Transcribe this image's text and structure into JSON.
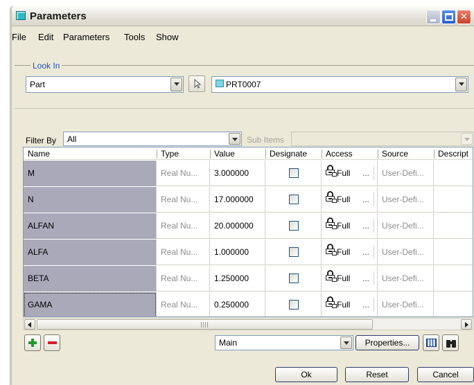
{
  "window": {
    "title": "Parameters"
  },
  "menu": [
    "File",
    "Edit",
    "Parameters",
    "Tools",
    "Show"
  ],
  "look_in": {
    "label": "Look In",
    "scope_value": "Part",
    "object_value": "PRT0007"
  },
  "filter": {
    "label": "Filter By",
    "value": "All",
    "sub_items_label": "Sub Items",
    "sub_items_value": ""
  },
  "table": {
    "columns": [
      "Name",
      "Type",
      "Value",
      "Designate",
      "Access",
      "Source",
      "Descript"
    ],
    "rows": [
      {
        "name": "M",
        "type": "Real Nu...",
        "value": "3.000000",
        "designate": false,
        "access": "Full",
        "access_more": "...",
        "source": "User-Defi..."
      },
      {
        "name": "N",
        "type": "Real Nu...",
        "value": "17.000000",
        "designate": false,
        "access": "Full",
        "access_more": "...",
        "source": "User-Defi..."
      },
      {
        "name": "ALFAN",
        "type": "Real Nu...",
        "value": "20.000000",
        "designate": false,
        "access": "Full",
        "access_more": "...",
        "source": "User-Defi..."
      },
      {
        "name": "ALFA",
        "type": "Real Nu...",
        "value": "1.000000",
        "designate": false,
        "access": "Full",
        "access_more": "...",
        "source": "User-Defi..."
      },
      {
        "name": "BETA",
        "type": "Real Nu...",
        "value": "1.250000",
        "designate": false,
        "access": "Full",
        "access_more": "...",
        "source": "User-Defi..."
      },
      {
        "name": "GAMA",
        "type": "Real Nu...",
        "value": "0.250000",
        "designate": false,
        "access": "Full",
        "access_more": "...",
        "source": "User-Defi..."
      }
    ]
  },
  "bottom_bar": {
    "view_value": "Main",
    "properties_label": "Properties..."
  },
  "dialog_buttons": {
    "ok": "Ok",
    "reset": "Reset",
    "cancel": "Cancel"
  },
  "colors": {
    "name_cell_bg": "#a9a9ba",
    "grid_border": "#7f9db9",
    "add_green": "#1f9a2a",
    "remove_red": "#d0202a"
  }
}
